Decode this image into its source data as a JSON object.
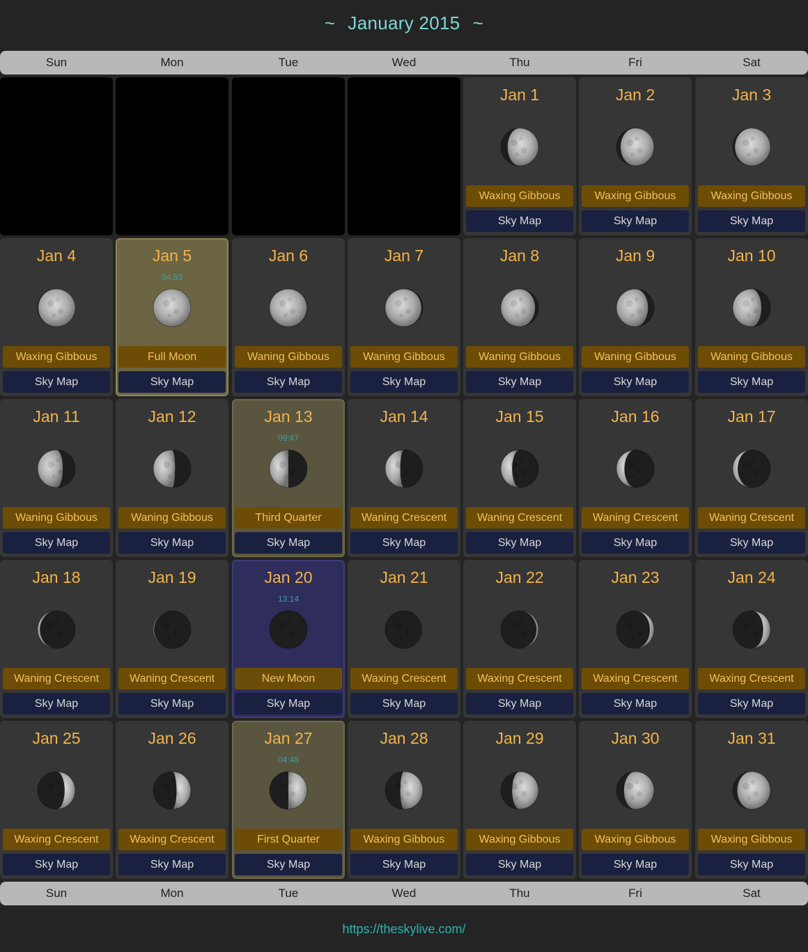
{
  "header": {
    "tilde_left": "~",
    "title": "January 2015",
    "tilde_right": "~"
  },
  "weekdays": [
    "Sun",
    "Mon",
    "Tue",
    "Wed",
    "Thu",
    "Fri",
    "Sat"
  ],
  "skymap_label": "Sky Map",
  "leading_empty_cells": 4,
  "days": [
    {
      "date": "Jan 1",
      "phase": "Waxing Gibbous",
      "illum": 0.82,
      "waxing": true
    },
    {
      "date": "Jan 2",
      "phase": "Waxing Gibbous",
      "illum": 0.89,
      "waxing": true
    },
    {
      "date": "Jan 3",
      "phase": "Waxing Gibbous",
      "illum": 0.94,
      "waxing": true
    },
    {
      "date": "Jan 4",
      "phase": "Waxing Gibbous",
      "illum": 0.98,
      "waxing": true
    },
    {
      "date": "Jan 5",
      "phase": "Full Moon",
      "time": "04:53",
      "illum": 1.0,
      "waxing": false,
      "highlight": "full"
    },
    {
      "date": "Jan 6",
      "phase": "Waning Gibbous",
      "illum": 0.99,
      "waxing": false
    },
    {
      "date": "Jan 7",
      "phase": "Waning Gibbous",
      "illum": 0.96,
      "waxing": false
    },
    {
      "date": "Jan 8",
      "phase": "Waning Gibbous",
      "illum": 0.91,
      "waxing": false
    },
    {
      "date": "Jan 9",
      "phase": "Waning Gibbous",
      "illum": 0.84,
      "waxing": false
    },
    {
      "date": "Jan 10",
      "phase": "Waning Gibbous",
      "illum": 0.76,
      "waxing": false
    },
    {
      "date": "Jan 11",
      "phase": "Waning Gibbous",
      "illum": 0.67,
      "waxing": false
    },
    {
      "date": "Jan 12",
      "phase": "Waning Gibbous",
      "illum": 0.58,
      "waxing": false
    },
    {
      "date": "Jan 13",
      "phase": "Third Quarter",
      "time": "09:47",
      "illum": 0.5,
      "waxing": false,
      "highlight": "quarter"
    },
    {
      "date": "Jan 14",
      "phase": "Waning Crescent",
      "illum": 0.4,
      "waxing": false
    },
    {
      "date": "Jan 15",
      "phase": "Waning Crescent",
      "illum": 0.3,
      "waxing": false
    },
    {
      "date": "Jan 16",
      "phase": "Waning Crescent",
      "illum": 0.21,
      "waxing": false
    },
    {
      "date": "Jan 17",
      "phase": "Waning Crescent",
      "illum": 0.13,
      "waxing": false
    },
    {
      "date": "Jan 18",
      "phase": "Waning Crescent",
      "illum": 0.06,
      "waxing": false
    },
    {
      "date": "Jan 19",
      "phase": "Waning Crescent",
      "illum": 0.02,
      "waxing": false
    },
    {
      "date": "Jan 20",
      "phase": "New Moon",
      "time": "13:14",
      "illum": 0.0,
      "waxing": true,
      "highlight": "new"
    },
    {
      "date": "Jan 21",
      "phase": "Waxing Crescent",
      "illum": 0.01,
      "waxing": true
    },
    {
      "date": "Jan 22",
      "phase": "Waxing Crescent",
      "illum": 0.05,
      "waxing": true
    },
    {
      "date": "Jan 23",
      "phase": "Waxing Crescent",
      "illum": 0.11,
      "waxing": true
    },
    {
      "date": "Jan 24",
      "phase": "Waxing Crescent",
      "illum": 0.19,
      "waxing": true
    },
    {
      "date": "Jan 25",
      "phase": "Waxing Crescent",
      "illum": 0.28,
      "waxing": true
    },
    {
      "date": "Jan 26",
      "phase": "Waxing Crescent",
      "illum": 0.38,
      "waxing": true
    },
    {
      "date": "Jan 27",
      "phase": "First Quarter",
      "time": "04:48",
      "illum": 0.5,
      "waxing": true,
      "highlight": "quarter"
    },
    {
      "date": "Jan 28",
      "phase": "Waxing Gibbous",
      "illum": 0.6,
      "waxing": true
    },
    {
      "date": "Jan 29",
      "phase": "Waxing Gibbous",
      "illum": 0.7,
      "waxing": true
    },
    {
      "date": "Jan 30",
      "phase": "Waxing Gibbous",
      "illum": 0.8,
      "waxing": true
    },
    {
      "date": "Jan 31",
      "phase": "Waxing Gibbous",
      "illum": 0.88,
      "waxing": true
    }
  ],
  "footer": {
    "url": "https://theskylive.com/"
  },
  "colors": {
    "background": "#242424",
    "title": "#7fd6d6",
    "date": "#f2b44a",
    "phase_bg": "#6d4c05",
    "phase_text": "#f2c062",
    "skymap_bg": "#1a2140",
    "full_bg": "#6b6543",
    "quarter_bg": "#5a553f",
    "new_bg": "#2f2d5c",
    "footer": "#2fb3b0"
  }
}
